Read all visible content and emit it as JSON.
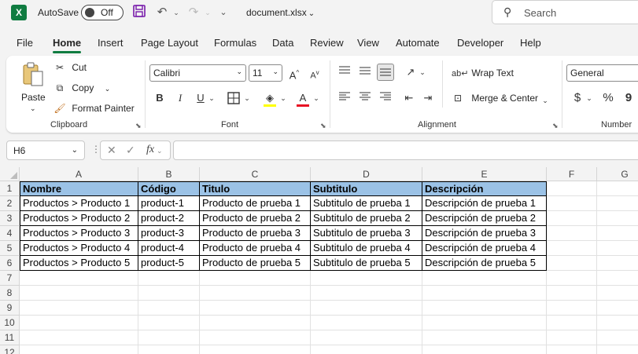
{
  "titlebar": {
    "app_icon": "X",
    "autosave_label": "AutoSave",
    "toggle_state": "Off",
    "document_title": "document.xlsx",
    "search_placeholder": "Search"
  },
  "menu_tabs": [
    "File",
    "Home",
    "Insert",
    "Page Layout",
    "Formulas",
    "Data",
    "Review",
    "View",
    "Automate",
    "Developer",
    "Help"
  ],
  "active_tab": "Home",
  "ribbon": {
    "clipboard": {
      "label": "Clipboard",
      "paste": "Paste",
      "cut": "Cut",
      "copy": "Copy",
      "format_painter": "Format Painter"
    },
    "font": {
      "label": "Font",
      "font_name": "Calibri",
      "font_size": "11",
      "bold": "B",
      "italic": "I",
      "underline": "U",
      "grow": "A",
      "shrink": "A",
      "font_color_letter": "A"
    },
    "alignment": {
      "label": "Alignment",
      "wrap_text": "Wrap Text",
      "merge_center": "Merge & Center"
    },
    "number": {
      "label": "Number",
      "format": "General",
      "currency": "$",
      "percent": "%",
      "comma": "9"
    }
  },
  "formula_bar": {
    "name_box": "H6",
    "fx": "fx",
    "value": ""
  },
  "sheet": {
    "columns": [
      "A",
      "B",
      "C",
      "D",
      "E",
      "F",
      "G"
    ],
    "row_numbers": [
      "1",
      "2",
      "3",
      "4",
      "5",
      "6",
      "7",
      "8",
      "9",
      "10",
      "11",
      "12"
    ],
    "header": [
      "Nombre",
      "Código",
      "Titulo",
      "Subtitulo",
      "Descripción"
    ],
    "rows": [
      [
        "Productos > Producto 1",
        "product-1",
        "Producto de prueba 1",
        "Subtitulo de prueba 1",
        "Descripción de prueba 1"
      ],
      [
        "Productos > Producto 2",
        "product-2",
        "Producto de prueba 2",
        "Subtitulo de prueba 2",
        "Descripción de prueba 2"
      ],
      [
        "Productos > Producto 3",
        "product-3",
        "Producto de prueba 3",
        "Subtitulo de prueba 3",
        "Descripción de prueba 3"
      ],
      [
        "Productos > Producto 4",
        "product-4",
        "Producto de prueba 4",
        "Subtitulo de prueba 4",
        "Descripción de prueba 4"
      ],
      [
        "Productos > Producto 5",
        "product-5",
        "Producto de prueba 5",
        "Subtitulo de prueba 5",
        "Descripción de prueba 5"
      ]
    ]
  },
  "colors": {
    "accent": "#107c41",
    "header_fill": "#9bc2e6",
    "font_color_bar": "#e81123"
  }
}
